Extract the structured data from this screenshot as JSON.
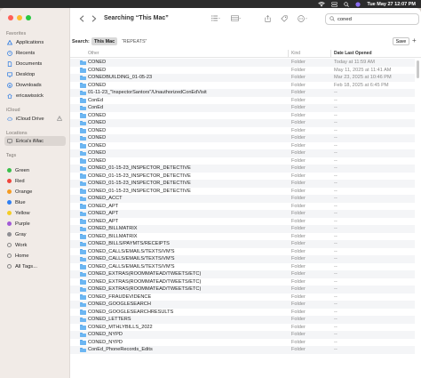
{
  "menubar": {
    "wifi_icon": "wifi-icon",
    "clock": "Tue May 27  12:07 PM"
  },
  "sidebar": {
    "sections": {
      "favorites": "Favorites",
      "icloud": "iCloud",
      "locations": "Locations",
      "tags": "Tags"
    },
    "favorites": [
      {
        "label": "Applications",
        "icon": "applications-icon"
      },
      {
        "label": "Recents",
        "icon": "clock-icon"
      },
      {
        "label": "Documents",
        "icon": "document-icon"
      },
      {
        "label": "Desktop",
        "icon": "desktop-icon"
      },
      {
        "label": "Downloads",
        "icon": "download-icon"
      },
      {
        "label": "ericawissick",
        "icon": "home-icon"
      }
    ],
    "icloud": [
      {
        "label": "iCloud Drive",
        "icon": "icloud-icon"
      }
    ],
    "locations": [
      {
        "label": "Erica's iMac",
        "icon": "imac-icon"
      }
    ],
    "tags": [
      {
        "label": "Green",
        "color": "#3bbf4a"
      },
      {
        "label": "Red",
        "color": "#f0453c"
      },
      {
        "label": "Orange",
        "color": "#f59b22"
      },
      {
        "label": "Blue",
        "color": "#2f7ff2"
      },
      {
        "label": "Yellow",
        "color": "#f4cd25"
      },
      {
        "label": "Purple",
        "color": "#a25ad6"
      },
      {
        "label": "Gray",
        "color": "#8e8e93"
      },
      {
        "label": "Work",
        "color": ""
      },
      {
        "label": "Home",
        "color": ""
      },
      {
        "label": "All Tags...",
        "color": ""
      }
    ]
  },
  "toolbar": {
    "title": "Searching “This Mac”",
    "search_value": "coned"
  },
  "scope": {
    "label": "Search:",
    "this_mac": "This Mac",
    "repeats": "“REPEATS”",
    "save": "Save",
    "add": "+"
  },
  "columns": {
    "name": "Other",
    "kind": "Kind",
    "date": "Date Last Opened"
  },
  "files": [
    {
      "name": "CONED",
      "kind": "Folder",
      "date": "Today at 11:59 AM"
    },
    {
      "name": "CONED",
      "kind": "Folder",
      "date": "May 11, 2025 at 11:41 AM"
    },
    {
      "name": "CONEDBUILDING_01-05-23",
      "kind": "Folder",
      "date": "Mar 23, 2025 at 10:46 PM"
    },
    {
      "name": "CONED",
      "kind": "Folder",
      "date": "Feb 18, 2025 at 6:45 PM"
    },
    {
      "name": "01-11-23_\"InspectorSantors\"/UnauthorizedConEdVisit",
      "kind": "Folder",
      "date": "--"
    },
    {
      "name": "ConEd",
      "kind": "Folder",
      "date": "--"
    },
    {
      "name": "ConEd",
      "kind": "Folder",
      "date": "--"
    },
    {
      "name": "CONED",
      "kind": "Folder",
      "date": "--"
    },
    {
      "name": "CONED",
      "kind": "Folder",
      "date": "--"
    },
    {
      "name": "CONED",
      "kind": "Folder",
      "date": "--"
    },
    {
      "name": "CONED",
      "kind": "Folder",
      "date": "--"
    },
    {
      "name": "CONED",
      "kind": "Folder",
      "date": "--"
    },
    {
      "name": "CONED",
      "kind": "Folder",
      "date": "--"
    },
    {
      "name": "CONED",
      "kind": "Folder",
      "date": "--"
    },
    {
      "name": "CONED_01-15-23_INSPECTOR_DETECTIVE",
      "kind": "Folder",
      "date": "--"
    },
    {
      "name": "CONED_01-15-23_INSPECTOR_DETECTIVE",
      "kind": "Folder",
      "date": "--"
    },
    {
      "name": "CONED_01-15-23_INSPECTOR_DETECTIVE",
      "kind": "Folder",
      "date": "--"
    },
    {
      "name": "CONED_01-15-23_INSPECTOR_DETECTIVE",
      "kind": "Folder",
      "date": "--"
    },
    {
      "name": "CONED_ACCT",
      "kind": "Folder",
      "date": "--"
    },
    {
      "name": "CONED_APT",
      "kind": "Folder",
      "date": "--"
    },
    {
      "name": "CONED_APT",
      "kind": "Folder",
      "date": "--"
    },
    {
      "name": "CONED_APT",
      "kind": "Folder",
      "date": "--"
    },
    {
      "name": "CONED_BILLMATRIX",
      "kind": "Folder",
      "date": "--"
    },
    {
      "name": "CONED_BILLMATRIX",
      "kind": "Folder",
      "date": "--"
    },
    {
      "name": "CONED_BILLS/PAYMTS/RECEIPTS",
      "kind": "Folder",
      "date": "--"
    },
    {
      "name": "CONED_CALLS/EMAILS/TEXTS/VM'S",
      "kind": "Folder",
      "date": "--"
    },
    {
      "name": "CONED_CALLS/EMAILS/TEXTS/VM'S",
      "kind": "Folder",
      "date": "--"
    },
    {
      "name": "CONED_CALLS/EMAILS/TEXTS/VM'S",
      "kind": "Folder",
      "date": "--"
    },
    {
      "name": "CONED_EXTRAS(ROOMMATEAD/TWEETS/ETC)",
      "kind": "Folder",
      "date": "--"
    },
    {
      "name": "CONED_EXTRAS(ROOMMATEAD/TWEETS/ETC)",
      "kind": "Folder",
      "date": "--"
    },
    {
      "name": "CONED_EXTRAS(ROOMMATEAD/TWEETS/ETC)",
      "kind": "Folder",
      "date": "--"
    },
    {
      "name": "CONED_FRAUDEVIDENCE",
      "kind": "Folder",
      "date": "--"
    },
    {
      "name": "CONED_GOOGLESEARCH",
      "kind": "Folder",
      "date": "--"
    },
    {
      "name": "CONED_GOOGLESEARCHRESULTS",
      "kind": "Folder",
      "date": "--"
    },
    {
      "name": "CONED_LETTERS",
      "kind": "Folder",
      "date": "--"
    },
    {
      "name": "CONED_MTHLYBILLS_2022",
      "kind": "Folder",
      "date": "--"
    },
    {
      "name": "CONED_NYPD",
      "kind": "Folder",
      "date": "--"
    },
    {
      "name": "CONED_NYPD",
      "kind": "Folder",
      "date": "--"
    },
    {
      "name": "ConEd_PhoneRecords_Edits",
      "kind": "Folder",
      "date": "--"
    }
  ]
}
